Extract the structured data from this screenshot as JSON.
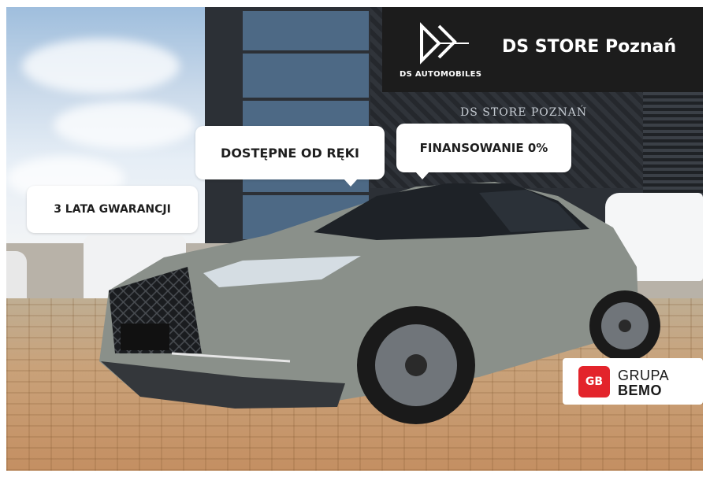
{
  "header": {
    "store_name": "DS STORE Poznań",
    "brand_sub": "DS AUTOMOBILES",
    "logo_icon": "ds-logo-icon"
  },
  "badges": {
    "warranty": "3 LATA GWARANCJI",
    "availability": "DOSTĘPNE OD RĘKI",
    "financing": "FINANSOWANIE 0%"
  },
  "background": {
    "building_sign": "DS STORE POZNAŃ"
  },
  "dealer": {
    "mark": "GB",
    "line1": "GRUPA",
    "line2": "BEMO",
    "accent_color": "#e3242b"
  },
  "colors": {
    "car_body": "#8a908a",
    "brand_band": "#1c1c1c"
  }
}
